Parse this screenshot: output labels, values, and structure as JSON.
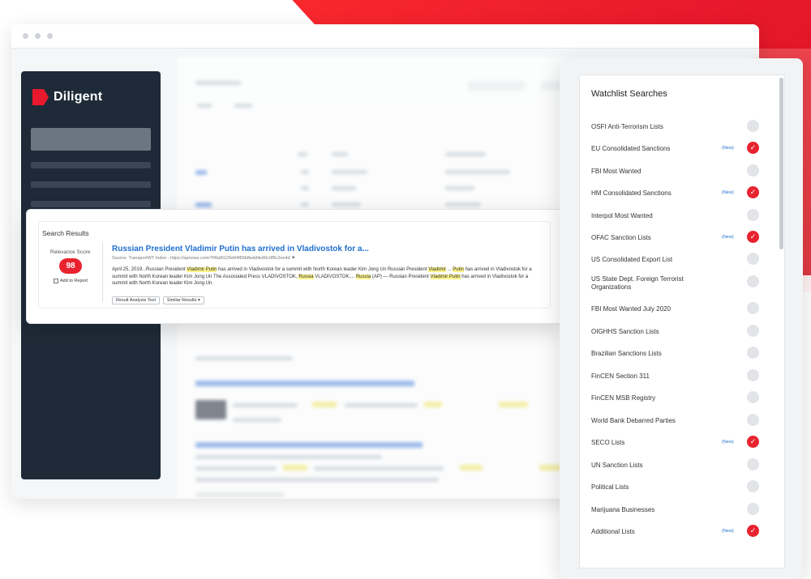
{
  "brand": {
    "name": "Diligent",
    "accent": "#e8232f"
  },
  "search_results": {
    "heading": "Search Results",
    "relevance_label": "Relevance Score",
    "relevance_score": "98",
    "add_to_report": "Add to Report",
    "article": {
      "title": "Russian President Vladimir Putin has arrived in Vladivostok for a...",
      "source": "Source: TransportWT Index - https://apnews.com/7f4bd0129d44f65b8edd4e90c9f8c2ee4d",
      "body_parts": [
        {
          "text": "April 25, 2019...Russian President ",
          "hl": false
        },
        {
          "text": "Vladimir Putin",
          "hl": true
        },
        {
          "text": " has arrived in Vladivostok for a summit with North Korean leader Kim Jong Un Russian President ",
          "hl": false
        },
        {
          "text": "Vladimir",
          "hl": true
        },
        {
          "text": " ... ",
          "hl": false
        },
        {
          "text": "Putin",
          "hl": true
        },
        {
          "text": " has arrived in Vladivostok for a summit with North Korean leader Kim Jong Un The Associated Press VLADIVOSTOK, ",
          "hl": false
        },
        {
          "text": "Russia",
          "hl": true
        },
        {
          "text": " VLADIVOSTOK.... ",
          "hl": false
        },
        {
          "text": "Russia",
          "hl": true
        },
        {
          "text": " (AP) — Russian President ",
          "hl": false
        },
        {
          "text": "Vladimir Putin",
          "hl": true
        },
        {
          "text": " has arrived in Vladivostok for a summit with North Korean leader Kim Jong Un.",
          "hl": false
        }
      ],
      "btn_analysis": "Result Analysis Tool",
      "btn_similar": "Similar Results ▾"
    }
  },
  "watchlist": {
    "title": "Watchlist Searches",
    "new_label": "(New)",
    "items": [
      {
        "name": "OSFI Anti-Terrorism Lists",
        "new": false,
        "checked": false
      },
      {
        "name": "EU Consolidated Sanctions",
        "new": true,
        "checked": true
      },
      {
        "name": "FBI Most Wanted",
        "new": false,
        "checked": false
      },
      {
        "name": "HM Consolidated Sanctions",
        "new": true,
        "checked": true
      },
      {
        "name": "Interpol Most Wanted",
        "new": false,
        "checked": false
      },
      {
        "name": "OFAC Sanction Lists",
        "new": true,
        "checked": true
      },
      {
        "name": "US Consolidated Export List",
        "new": false,
        "checked": false
      },
      {
        "name": "US State Dept. Foreign Terrorist Organizations",
        "new": false,
        "checked": false
      },
      {
        "name": "FBI Most Wanted July 2020",
        "new": false,
        "checked": false
      },
      {
        "name": "OIGHHS Sanction Lists",
        "new": false,
        "checked": false
      },
      {
        "name": "Brazilian Sanctions Lists",
        "new": false,
        "checked": false
      },
      {
        "name": "FinCEN Section 311",
        "new": false,
        "checked": false
      },
      {
        "name": "FinCEN MSB Registry",
        "new": false,
        "checked": false
      },
      {
        "name": "World Bank Debarred Parties",
        "new": false,
        "checked": false
      },
      {
        "name": "SECO Lists",
        "new": true,
        "checked": true
      },
      {
        "name": "UN Sanction Lists",
        "new": false,
        "checked": false
      },
      {
        "name": "Political Lists",
        "new": false,
        "checked": false
      },
      {
        "name": "Marijuana Businesses",
        "new": false,
        "checked": false
      },
      {
        "name": "Additional Lists",
        "new": true,
        "checked": true
      }
    ]
  }
}
